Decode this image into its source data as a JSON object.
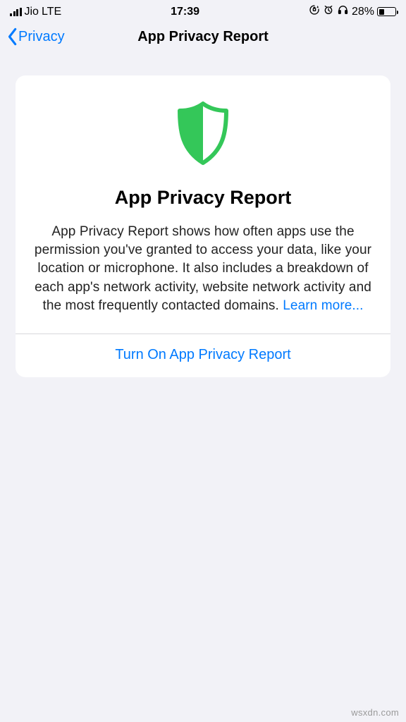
{
  "status": {
    "carrier": "Jio",
    "network": "LTE",
    "time": "17:39",
    "battery_pct": "28%"
  },
  "nav": {
    "back_label": "Privacy",
    "title": "App Privacy Report"
  },
  "card": {
    "title": "App Privacy Report",
    "description": "App Privacy Report shows how often apps use the permission you've granted to access your data, like your location or microphone. It also includes a breakdown of each app's network activity, website network activity and the most frequently contacted domains. ",
    "learn_more": "Learn more...",
    "action": "Turn On App Privacy Report"
  },
  "watermark": "wsxdn.com"
}
